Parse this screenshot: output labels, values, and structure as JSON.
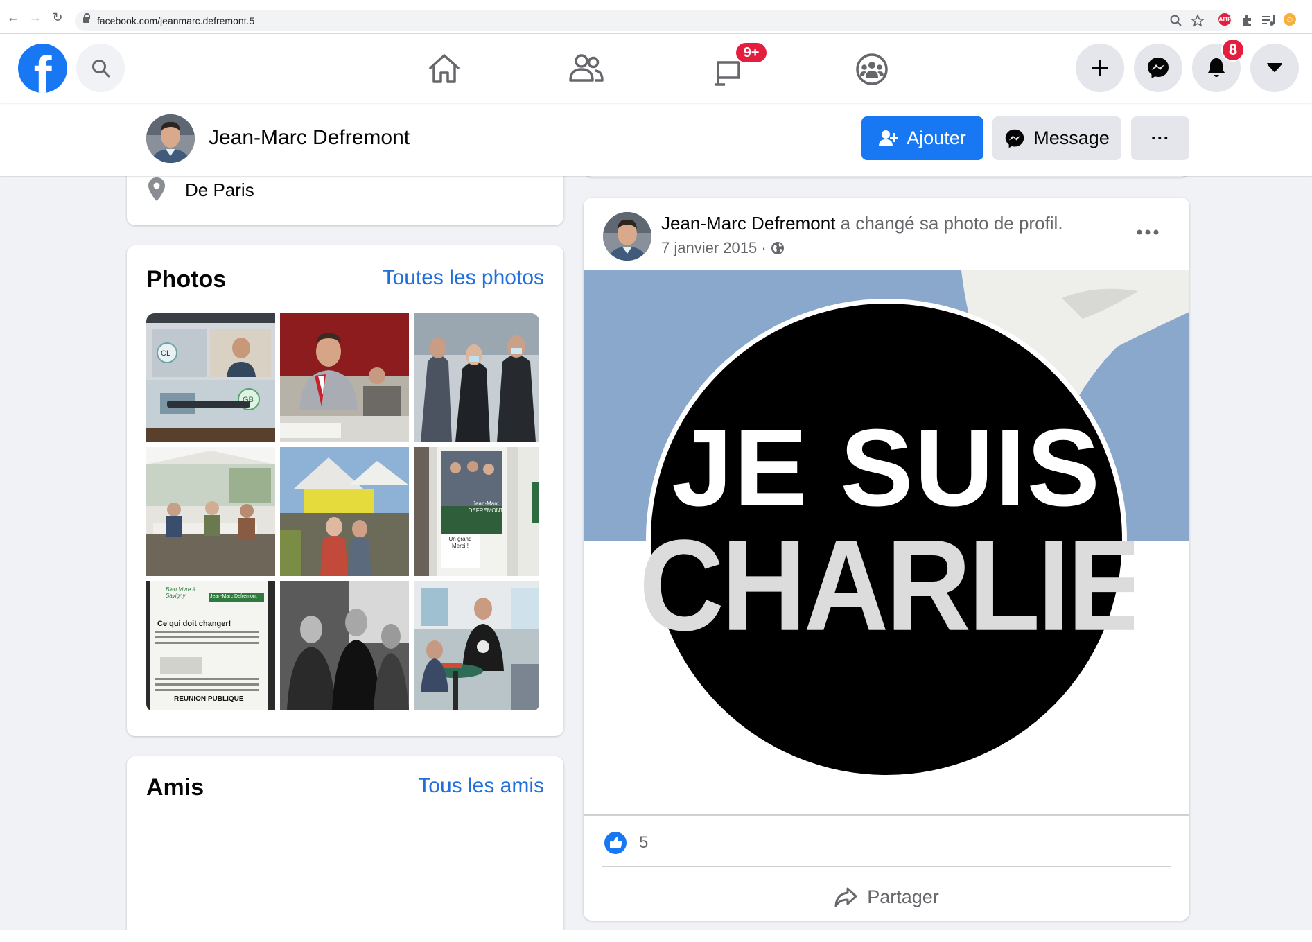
{
  "browser": {
    "url": "facebook.com/jeanmarc.defremont.5"
  },
  "topbar": {
    "logo": "f",
    "watch_badge": "9+",
    "notifications_badge": "8",
    "icons": [
      "search-icon",
      "home-icon",
      "friends-icon",
      "watch-icon",
      "groups-icon",
      "create-icon",
      "messenger-icon",
      "bell-icon",
      "account-menu-icon"
    ]
  },
  "profile": {
    "name": "Jean-Marc Defremont",
    "add_label": "Ajouter",
    "message_label": "Message",
    "more_label": "···"
  },
  "intro": {
    "from_prefix": "De ",
    "from_city": "Paris"
  },
  "photos": {
    "title": "Photos",
    "see_all": "Toutes les photos",
    "thumb_texts": {
      "cl": "CL",
      "gb": "GB",
      "sign_name": "Jean-Marc DEFREMONT",
      "sign_merci": "Un grand Merci !",
      "flyer_brand": "Bien Vivre à Savigny",
      "flyer_name": "Jean-Marc Defremont",
      "flyer_heading": "Ce qui doit changer!",
      "flyer_footer": "REUNION PUBLIQUE"
    }
  },
  "friends": {
    "title": "Amis",
    "see_all": "Tous les amis"
  },
  "post": {
    "author": "Jean-Marc Defremont",
    "action": " a changé sa photo de profil.",
    "date": "7 janvier 2015 ·",
    "image_line1": "JE SUIS",
    "image_line2": "CHARLIE",
    "likes": "5",
    "share_label": "Partager"
  },
  "colors": {
    "facebook_blue": "#1877f2",
    "link_blue": "#216fdb",
    "badge_red": "#e41e3f",
    "page_bg": "#f0f2f5"
  }
}
